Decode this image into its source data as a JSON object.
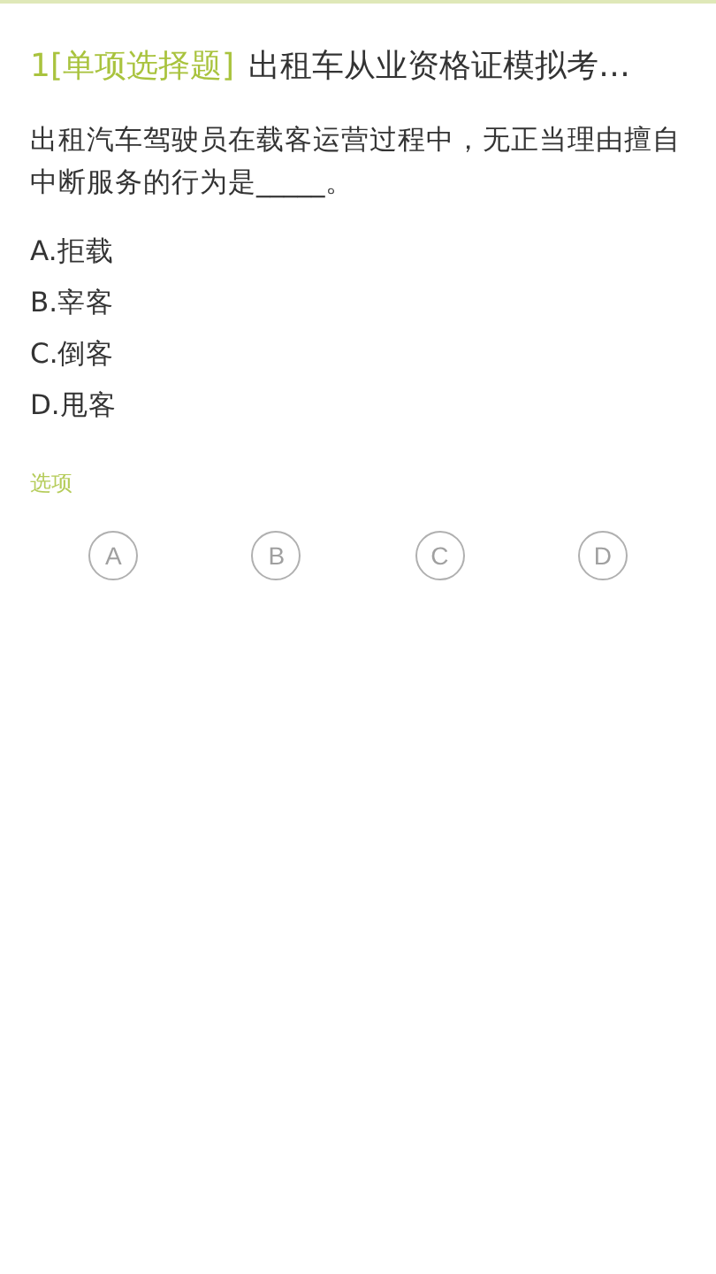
{
  "header": {
    "number": "1",
    "type_label": "[单项选择题]",
    "title": "出租车从业资格证模拟考…"
  },
  "question": "出租汽车驾驶员在载客运营过程中，无正当理由擅自中断服务的行为是_____。",
  "options": [
    "A.拒载",
    "B.宰客",
    "C.倒客",
    "D.甩客"
  ],
  "choices_label": "选项",
  "choices": [
    {
      "letter": "A",
      "selected": false
    },
    {
      "letter": "B",
      "selected": false
    },
    {
      "letter": "C",
      "selected": false
    },
    {
      "letter": "D",
      "selected": false
    }
  ]
}
